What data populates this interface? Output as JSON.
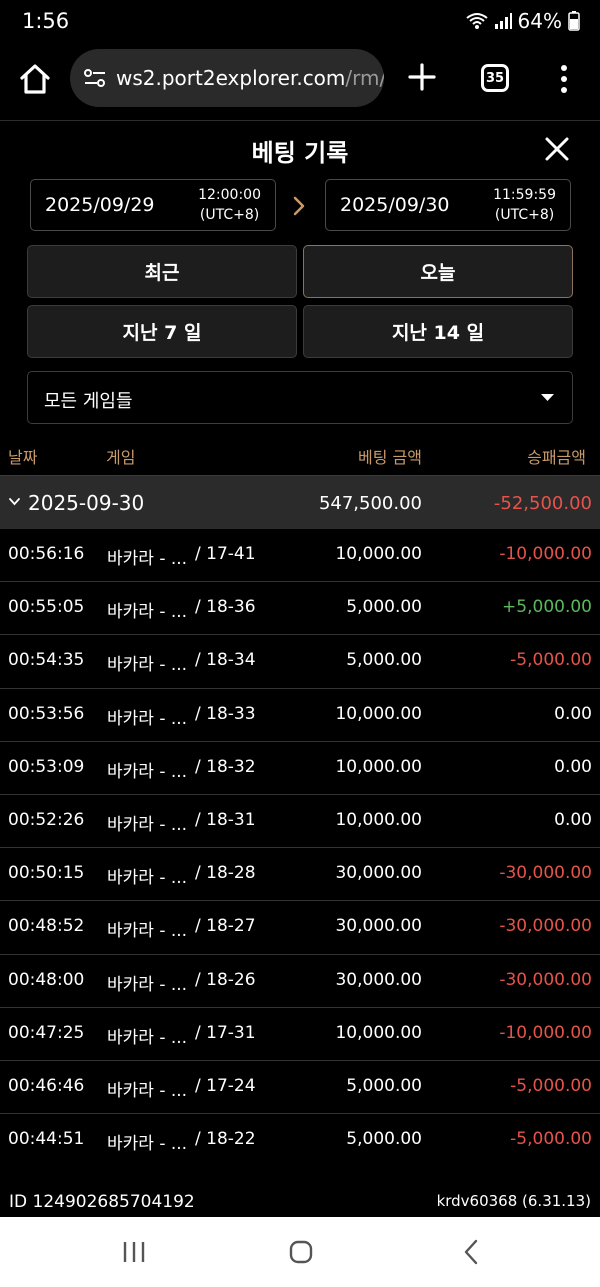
{
  "status": {
    "time": "1:56",
    "battery": "64%"
  },
  "browser": {
    "url_host": "ws2.port2explorer.com",
    "url_path": "/rm/",
    "tab_count": "35"
  },
  "modal": {
    "title": "베팅 기록"
  },
  "date_range": {
    "start_date": "2025/09/29",
    "start_time": "12:00:00",
    "start_tz": "(UTC+8)",
    "end_date": "2025/09/30",
    "end_time": "11:59:59",
    "end_tz": "(UTC+8)"
  },
  "quick_filters": {
    "recent": "최근",
    "today": "오늘",
    "last7": "지난 7 일",
    "last14": "지난 14 일",
    "active": "today"
  },
  "game_filter": {
    "selected": "모든 게임들"
  },
  "table": {
    "headers": {
      "date": "날짜",
      "game": "게임",
      "bet": "베팅 금액",
      "pl": "승패금액"
    },
    "group": {
      "date": "2025-09-30",
      "bet_total": "547,500.00",
      "pl_total": "-52,500.00"
    },
    "rows": [
      {
        "time": "00:56:16",
        "game": "바카라 - ...",
        "round": "/ 17-41",
        "bet": "10,000.00",
        "pl": "-10,000.00",
        "sign": "neg"
      },
      {
        "time": "00:55:05",
        "game": "바카라 - ...",
        "round": "/ 18-36",
        "bet": "5,000.00",
        "pl": "+5,000.00",
        "sign": "pos"
      },
      {
        "time": "00:54:35",
        "game": "바카라 - ...",
        "round": "/ 18-34",
        "bet": "5,000.00",
        "pl": "-5,000.00",
        "sign": "neg"
      },
      {
        "time": "00:53:56",
        "game": "바카라 - ...",
        "round": "/ 18-33",
        "bet": "10,000.00",
        "pl": "0.00",
        "sign": "zero"
      },
      {
        "time": "00:53:09",
        "game": "바카라 - ...",
        "round": "/ 18-32",
        "bet": "10,000.00",
        "pl": "0.00",
        "sign": "zero"
      },
      {
        "time": "00:52:26",
        "game": "바카라 - ...",
        "round": "/ 18-31",
        "bet": "10,000.00",
        "pl": "0.00",
        "sign": "zero"
      },
      {
        "time": "00:50:15",
        "game": "바카라 - ...",
        "round": "/ 18-28",
        "bet": "30,000.00",
        "pl": "-30,000.00",
        "sign": "neg"
      },
      {
        "time": "00:48:52",
        "game": "바카라 - ...",
        "round": "/ 18-27",
        "bet": "30,000.00",
        "pl": "-30,000.00",
        "sign": "neg"
      },
      {
        "time": "00:48:00",
        "game": "바카라 - ...",
        "round": "/ 18-26",
        "bet": "30,000.00",
        "pl": "-30,000.00",
        "sign": "neg"
      },
      {
        "time": "00:47:25",
        "game": "바카라 - ...",
        "round": "/ 17-31",
        "bet": "10,000.00",
        "pl": "-10,000.00",
        "sign": "neg"
      },
      {
        "time": "00:46:46",
        "game": "바카라 - ...",
        "round": "/ 17-24",
        "bet": "5,000.00",
        "pl": "-5,000.00",
        "sign": "neg"
      },
      {
        "time": "00:44:51",
        "game": "바카라 - ...",
        "round": "/ 18-22",
        "bet": "5,000.00",
        "pl": "-5,000.00",
        "sign": "neg"
      }
    ]
  },
  "footer": {
    "id": "ID 124902685704192",
    "user": "krdv60368  (6.31.13)"
  },
  "colors": {
    "negative": "#e5534b",
    "positive": "#5cb85c",
    "accent": "#c89a6a"
  }
}
